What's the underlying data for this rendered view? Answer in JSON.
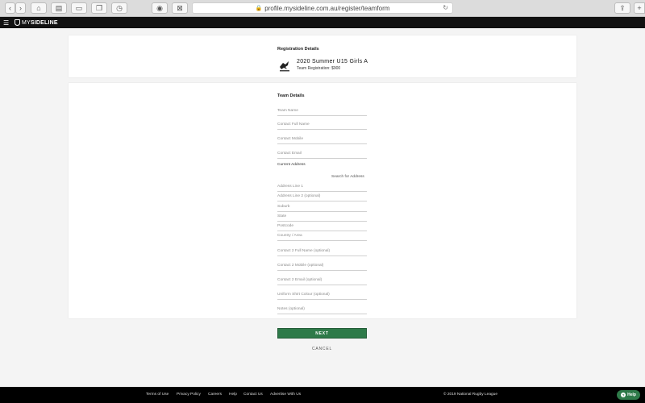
{
  "browser": {
    "url": "profile.mysideline.com.au/register/teamform",
    "back_icon": "chevron-left-icon",
    "forward_icon": "chevron-right-icon",
    "buttons": [
      "home-icon",
      "print-icon",
      "sidebar-icon",
      "tabs-icon",
      "history-icon",
      "extension-icon",
      "close-icon",
      "share-icon",
      "new-tab-icon"
    ]
  },
  "header": {
    "menu_icon": "☰",
    "logo_prefix": "MY",
    "logo_suffix": "SIDELINE"
  },
  "registration": {
    "title": "Registration Details",
    "event_name": "2020 Summer U15 Girls A",
    "fee": "Team Registration: $900"
  },
  "team": {
    "title": "Team Details",
    "fields_top": [
      {
        "placeholder": "Team Name"
      },
      {
        "placeholder": "Contact Full Name"
      },
      {
        "placeholder": "Contact Mobile"
      },
      {
        "placeholder": "Contact Email"
      }
    ],
    "address_label": "Current Address",
    "search_address": "Search for Address",
    "address_fields": [
      {
        "placeholder": "Address Line 1"
      },
      {
        "placeholder": "Address Line 2 (optional)"
      },
      {
        "placeholder": "Suburb"
      },
      {
        "placeholder": "State"
      },
      {
        "placeholder": "Postcode"
      },
      {
        "placeholder": "Country / Area"
      }
    ],
    "fields_bottom": [
      {
        "placeholder": "Contact 2 Full Name (optional)"
      },
      {
        "placeholder": "Contact 2 Mobile (optional)"
      },
      {
        "placeholder": "Contact 2 Email (optional)"
      },
      {
        "placeholder": "Uniform Shirt Colour (optional)"
      },
      {
        "placeholder": "Notes (optional)"
      }
    ]
  },
  "actions": {
    "next": "NEXT",
    "cancel": "CANCEL"
  },
  "footer": {
    "links": [
      "Terms of Use",
      "Privacy Policy",
      "Careers",
      "Help",
      "Contact Us",
      "Advertise With Us"
    ],
    "copyright": "© 2019 National Rugby League"
  },
  "help": {
    "label": "Help",
    "icon": "?"
  },
  "colors": {
    "accent": "#2e7a49",
    "header_bg": "#111111",
    "footer_bg": "#000000"
  }
}
